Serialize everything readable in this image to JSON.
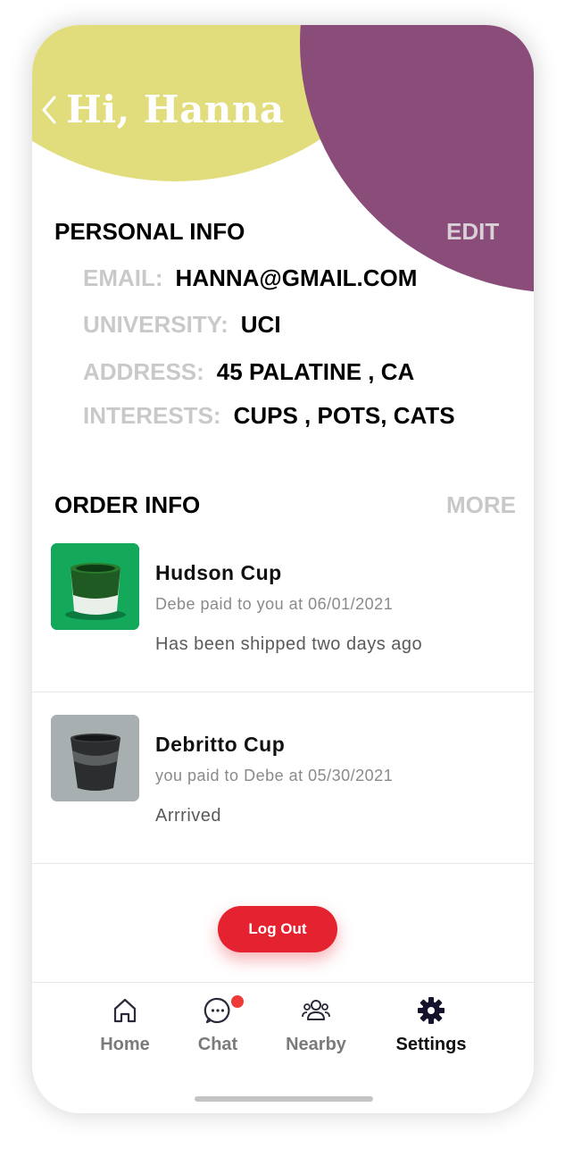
{
  "header": {
    "greeting": "Hi, Hanna"
  },
  "personal_info": {
    "title": "PERSONAL INFO",
    "edit_label": "EDIT",
    "rows": [
      {
        "label": "EMAIL:",
        "value": "HANNA@GMAIL.COM"
      },
      {
        "label": "UNIVERSITY:",
        "value": "UCI"
      },
      {
        "label": "ADDRESS:",
        "value": "45 PALATINE , CA"
      },
      {
        "label": "INTERESTS:",
        "value": "CUPS , POTS, CATS"
      }
    ]
  },
  "order_info": {
    "title": "ORDER INFO",
    "more_label": "MORE",
    "orders": [
      {
        "name": "Hudson Cup",
        "payment": "Debe paid to you at 06/01/2021",
        "status": "Has been shipped two days ago",
        "thumb_color": "#12a95b"
      },
      {
        "name": "Debritto Cup",
        "payment": "you paid to Debe at 05/30/2021",
        "status": "Arrrived",
        "thumb_color": "#9ea6a7"
      }
    ]
  },
  "logout_label": "Log Out",
  "tabs": [
    {
      "label": "Home",
      "icon": "home-icon",
      "active": false
    },
    {
      "label": "Chat",
      "icon": "chat-icon",
      "active": false,
      "badge": true
    },
    {
      "label": "Nearby",
      "icon": "people-icon",
      "active": false
    },
    {
      "label": "Settings",
      "icon": "gear-icon",
      "active": true
    }
  ],
  "colors": {
    "yellow": "#e2dd7c",
    "purple": "#8a4d7a",
    "accent_red": "#e5222f"
  }
}
